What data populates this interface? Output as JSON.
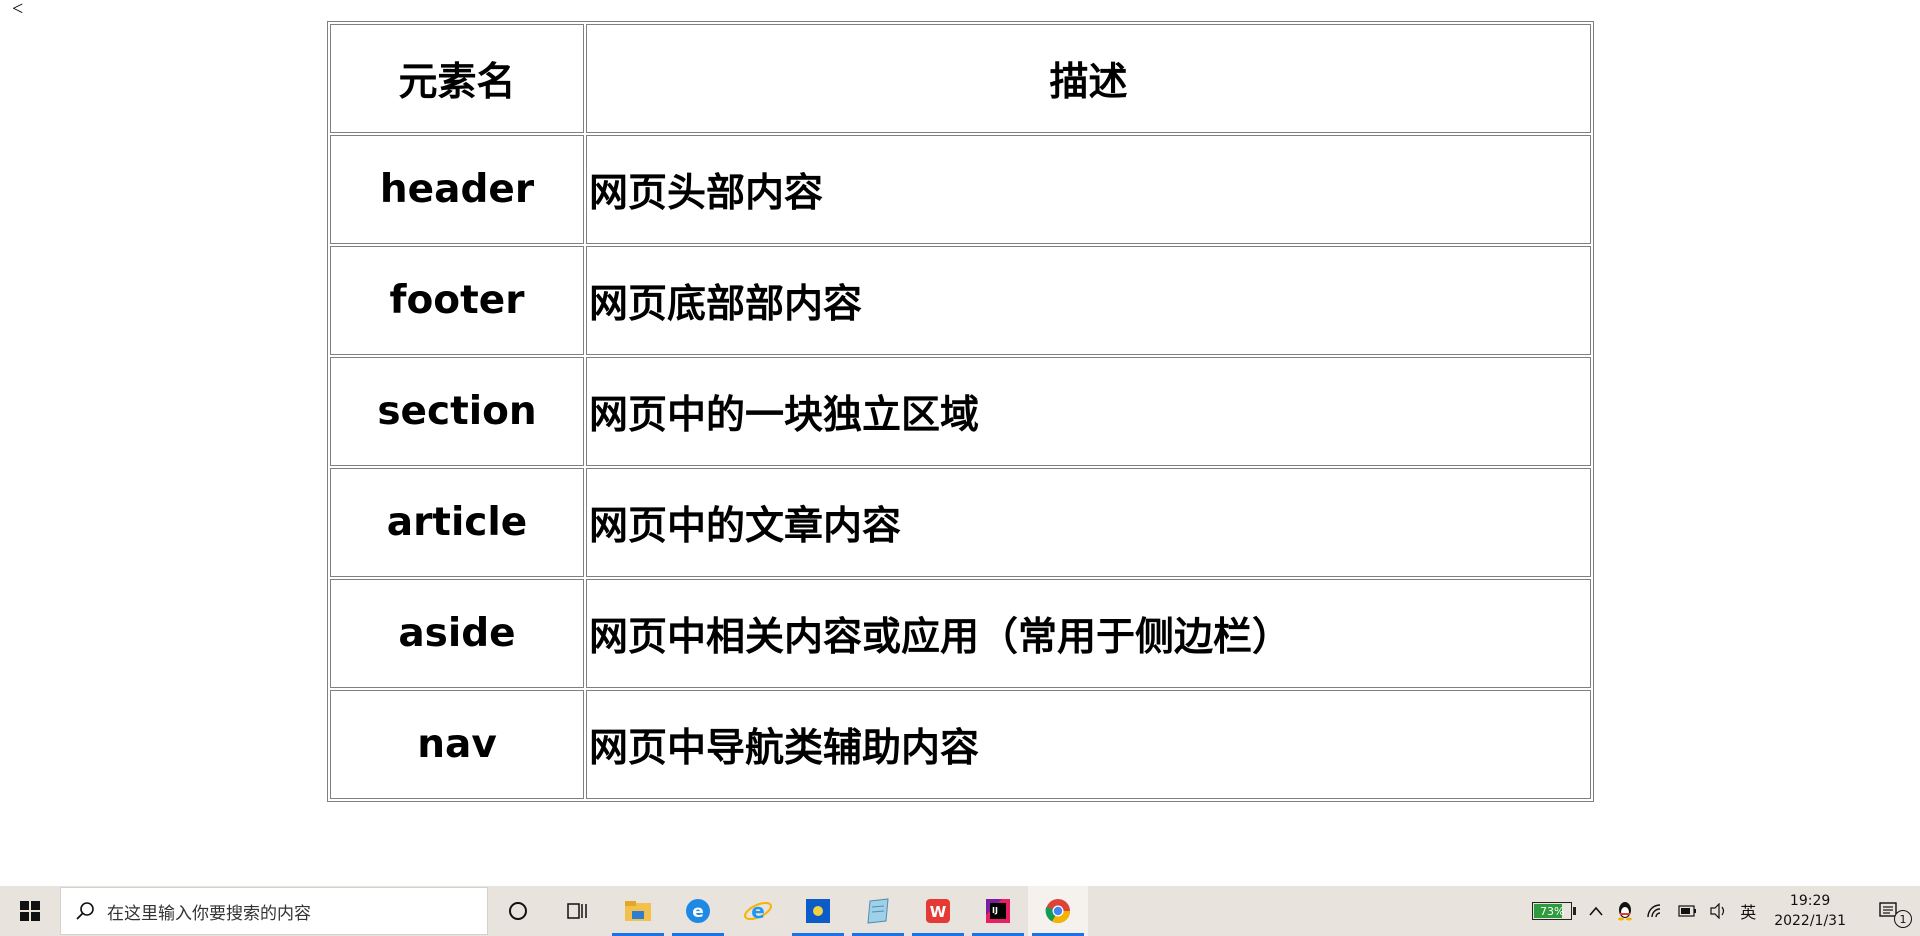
{
  "page": {
    "stray_text": "<"
  },
  "table": {
    "headers": [
      "元素名",
      "描述"
    ],
    "rows": [
      {
        "name": "header",
        "desc": "网页头部内容"
      },
      {
        "name": "footer",
        "desc": "网页底部部内容"
      },
      {
        "name": "section",
        "desc": "网页中的一块独立区域"
      },
      {
        "name": "article",
        "desc": "网页中的文章内容"
      },
      {
        "name": "aside",
        "desc": "网页中相关内容或应用（常用于侧边栏）"
      },
      {
        "name": "nav",
        "desc": "网页中导航类辅助内容"
      }
    ]
  },
  "taskbar": {
    "search_placeholder": "在这里输入你要搜索的内容",
    "pinned_apps": [
      {
        "icon": "file-explorer-icon",
        "active": true
      },
      {
        "icon": "edge-legacy-icon",
        "active": true
      },
      {
        "icon": "internet-explorer-icon",
        "active": false
      },
      {
        "icon": "blue-app-icon",
        "active": true
      },
      {
        "icon": "notepad-icon",
        "active": true
      },
      {
        "icon": "wps-icon",
        "active": true
      },
      {
        "icon": "intellij-idea-icon",
        "active": true
      },
      {
        "icon": "chrome-icon",
        "active": true,
        "current": true
      }
    ],
    "battery_percent": "73%",
    "battery_level": 0.73,
    "ime": "英",
    "time": "19:29",
    "date": "2022/1/31",
    "notification_count": "1"
  },
  "colors": {
    "taskbar_bg": "#e9e3dd",
    "active_indicator": "#1a73e8",
    "battery_fill": "#2e9b3f"
  }
}
